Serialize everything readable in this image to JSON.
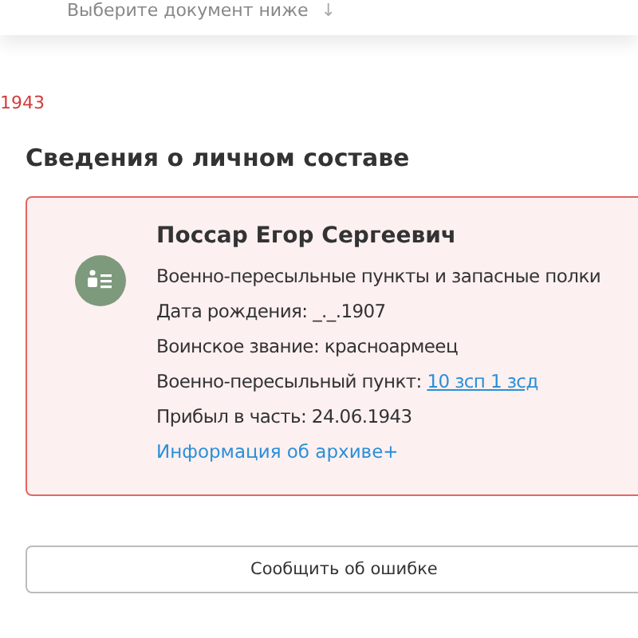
{
  "top_panel": {
    "hint": "Выберите документ ниже",
    "hint_arrow": "↓"
  },
  "date_fragment": "1943",
  "section": {
    "title": "Сведения о личном составе"
  },
  "person_card": {
    "name": "Поссар Егор Сергеевич",
    "fields": [
      {
        "kind": "text",
        "text": "Военно-пересыльные пункты и запасные полки"
      },
      {
        "kind": "pair",
        "label": "Дата рождения:",
        "value": "_._.1907"
      },
      {
        "kind": "pair",
        "label": "Воинское звание:",
        "value": "красноармеец"
      },
      {
        "kind": "link",
        "label": "Военно-пересыльный пункт:",
        "value": "10 зсп 1 зсд"
      },
      {
        "kind": "pair",
        "label": "Прибыл в часть:",
        "value": "24.06.1943"
      }
    ],
    "archive_link": "Информация об архиве+"
  },
  "report_button": "Сообщить об ошибке"
}
